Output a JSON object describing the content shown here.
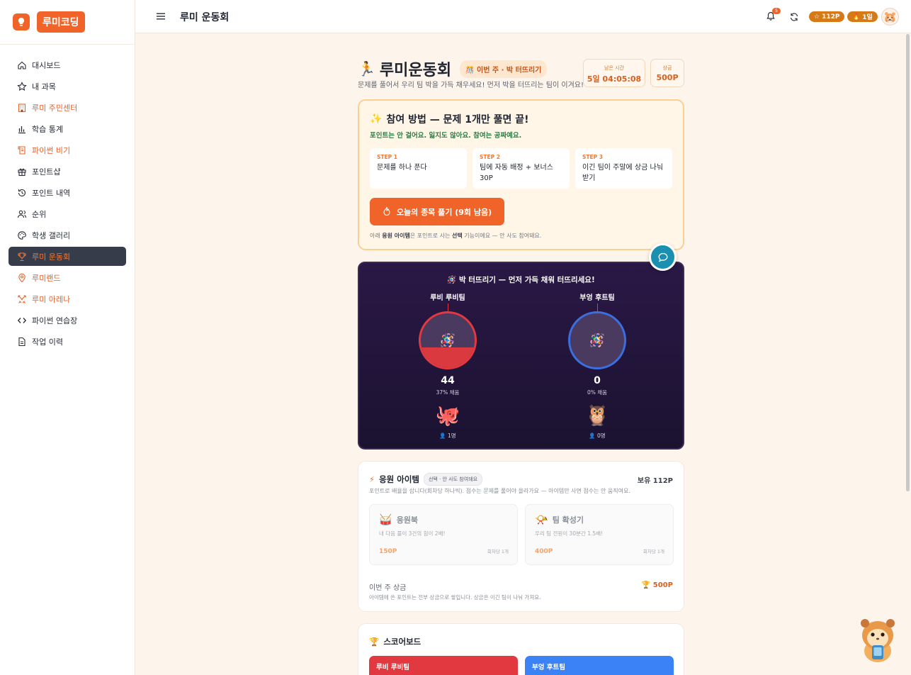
{
  "app": {
    "logo_text": "루미코딩",
    "page_title": "루미 운동회"
  },
  "sidebar": {
    "items": [
      {
        "label": "대시보드",
        "icon": "home-icon"
      },
      {
        "label": "내 과목",
        "icon": "star-icon"
      },
      {
        "label": "루미 주민센터",
        "icon": "building-icon"
      },
      {
        "label": "학습 통계",
        "icon": "chart-icon"
      },
      {
        "label": "파이썬 비기",
        "icon": "scroll-icon"
      },
      {
        "label": "포인트샵",
        "icon": "gift-icon"
      },
      {
        "label": "포인트 내역",
        "icon": "history-icon"
      },
      {
        "label": "순위",
        "icon": "users-icon"
      },
      {
        "label": "학생 갤러리",
        "icon": "palette-icon"
      },
      {
        "label": "루미 운동회",
        "icon": "trophy-icon"
      },
      {
        "label": "루미랜드",
        "icon": "map-pin-icon"
      },
      {
        "label": "루미 아레나",
        "icon": "swords-icon"
      },
      {
        "label": "파이썬 연습장",
        "icon": "code-icon"
      },
      {
        "label": "작업 이력",
        "icon": "file-icon"
      }
    ]
  },
  "topbar": {
    "notification_count": "5",
    "points": "112P",
    "streak": "1일"
  },
  "hero": {
    "title": "루미운동회",
    "week_tag": "이번 주 · 박 터뜨리기",
    "subtitle": "문제를 풀어서 우리 팀 박을 가득 채우세요! 먼저 박을 터뜨리는 팀이 이겨요!",
    "time_label": "남은 시간",
    "time_value": "5일 04:05:08",
    "prize_label": "상금",
    "prize_value": "500P"
  },
  "guide": {
    "title": "참여 방법 — 문제 1개만 풀면 끝!",
    "subtitle": "포인트는 안 걸어요. 잃지도 않아요. 참여는 공짜예요.",
    "steps": [
      {
        "num": "STEP 1",
        "text": "문제를 하나 푼다"
      },
      {
        "num": "STEP 2",
        "text": "팀에 자동 배정 + 보너스 30P"
      },
      {
        "num": "STEP 3",
        "text": "이긴 팀이 주말에 상금 나눠 받기"
      }
    ],
    "cta": "오늘의 종목 풀기 (9회 남음)",
    "note_pre": "아래 ",
    "note_b1": "응원 아이템",
    "note_mid": "은 포인트로 사는 ",
    "note_b2": "선택",
    "note_post": " 기능이에요 — 안 사도 참여돼요."
  },
  "arena": {
    "title": "🪅 박 터뜨리기 — 먼저 가득 채워 터뜨리세요!",
    "teams": [
      {
        "name": "루비 루비팀",
        "score": "44",
        "fill_text": "37% 채움",
        "fill_ratio": 0.37,
        "members": "1명",
        "color": "#e2383f",
        "mascot": "🐙"
      },
      {
        "name": "부엉 후트팀",
        "score": "0",
        "fill_text": "0% 채움",
        "fill_ratio": 0,
        "members": "0명",
        "color": "#3b6fe0",
        "mascot": "🦉"
      }
    ]
  },
  "items": {
    "title": "응원 아이템",
    "tag": "선택 · 안 사도 참여돼요",
    "owned": "보유 112P",
    "subtitle": "포인트로 배율을 삽니다(회차당 하나씩). 점수는 문제를 풀어야 올라가요 — 아이템만 사면 점수는 안 움직여요.",
    "cards": [
      {
        "name": "응원북",
        "icon": "🥁",
        "desc": "내 다음 풀이 3건의 힘이 2배!",
        "price": "150P",
        "limit": "회차당 1개"
      },
      {
        "name": "팀 확성기",
        "icon": "📯",
        "desc": "우리 팀 전원이 30분간 1.5배!",
        "price": "400P",
        "limit": "회차당 1개"
      }
    ],
    "prize_label": "이번 주 상금",
    "prize_value": "🏆 500P",
    "prize_note": "아이템에 쓴 포인트는 전부 상금으로 쌓입니다. 상금은 이긴 팀이 나눠 가져요."
  },
  "scoreboard": {
    "title": "스코어보드",
    "teams": [
      {
        "name": "루비 루비팀",
        "color": "#e2383f"
      },
      {
        "name": "부엉 후트팀",
        "color": "#3b82f6"
      }
    ]
  }
}
